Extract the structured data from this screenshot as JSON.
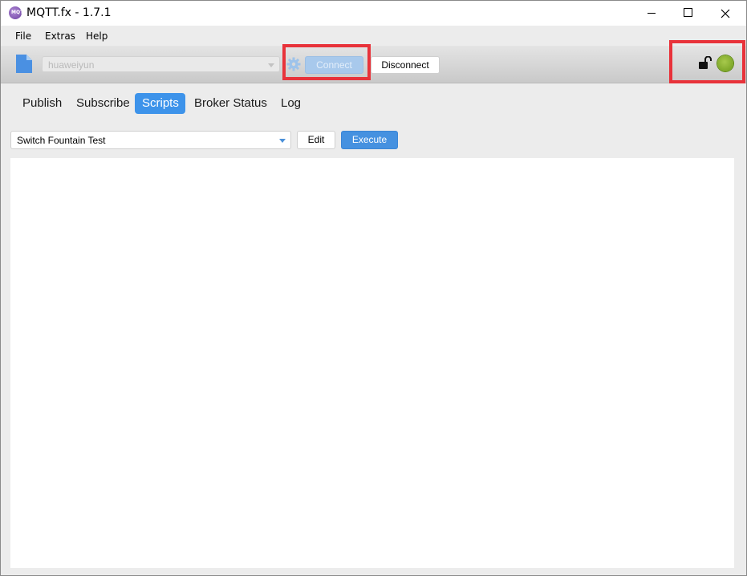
{
  "window": {
    "title": "MQTT.fx - 1.7.1",
    "app_icon_text": "MQTT"
  },
  "menu": {
    "items": [
      {
        "label": "File"
      },
      {
        "label": "Extras"
      },
      {
        "label": "Help"
      }
    ]
  },
  "toolbar": {
    "profile": "huaweiyun",
    "connect_label": "Connect",
    "disconnect_label": "Disconnect",
    "connection_status": "connected",
    "status_color": "#8ab532",
    "highlight_color": "#e8323a"
  },
  "tabs": [
    {
      "label": "Publish",
      "active": false
    },
    {
      "label": "Subscribe",
      "active": false
    },
    {
      "label": "Scripts",
      "active": true
    },
    {
      "label": "Broker Status",
      "active": false
    },
    {
      "label": "Log",
      "active": false
    }
  ],
  "scripts": {
    "selected": "Switch Fountain Test",
    "edit_label": "Edit",
    "execute_label": "Execute",
    "accent_color": "#4591e0"
  }
}
